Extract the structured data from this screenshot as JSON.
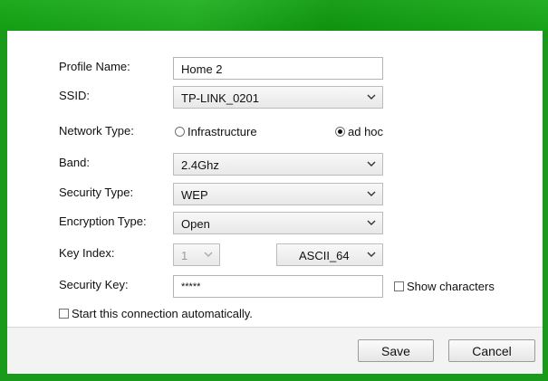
{
  "form": {
    "profile_name_label": "Profile Name:",
    "profile_name_value": "Home 2",
    "ssid_label": "SSID:",
    "ssid_value": "TP-LINK_0201",
    "network_type_label": "Network Type:",
    "network_type_options": [
      "Infrastructure",
      "ad hoc"
    ],
    "network_type_selected": "ad hoc",
    "band_label": "Band:",
    "band_value": "2.4Ghz",
    "security_type_label": "Security Type:",
    "security_type_value": "WEP",
    "encryption_type_label": "Encryption Type:",
    "encryption_type_value": "Open",
    "key_index_label": "Key Index:",
    "key_index_value": "1",
    "key_format_value": "ASCII_64",
    "security_key_label": "Security Key:",
    "security_key_value": "*****",
    "show_characters_label": "Show characters",
    "show_characters_checked": false,
    "auto_connect_label": "Start this connection automatically.",
    "auto_connect_checked": false
  },
  "buttons": {
    "save_label": "Save",
    "cancel_label": "Cancel"
  },
  "colors": {
    "frame": "#1a9a1a",
    "panel": "#ffffff",
    "footer": "#f3f3f3"
  },
  "icons": {
    "dropdown": "chevron-down-icon"
  }
}
